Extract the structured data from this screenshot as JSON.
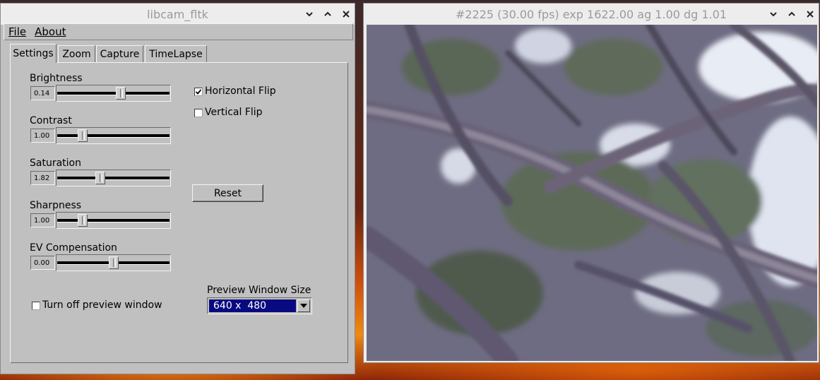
{
  "ctrl_window": {
    "title": "libcam_fltk",
    "menu": {
      "file": "File",
      "about": "About"
    },
    "tabs": [
      {
        "label": "Settings",
        "active": true
      },
      {
        "label": "Zoom",
        "active": false
      },
      {
        "label": "Capture",
        "active": false
      },
      {
        "label": "TimeLapse",
        "active": false
      }
    ],
    "sliders": [
      {
        "label": "Brightness",
        "value": "0.14",
        "min": -1.0,
        "max": 1.0,
        "position": 0.57
      },
      {
        "label": "Contrast",
        "value": "1.00",
        "min": 0.0,
        "max": 5.0,
        "position": 0.2
      },
      {
        "label": "Saturation",
        "value": "1.82",
        "min": 0.0,
        "max": 5.0,
        "position": 0.37
      },
      {
        "label": "Sharpness",
        "value": "1.00",
        "min": 0.0,
        "max": 5.0,
        "position": 0.2
      },
      {
        "label": "EV Compensation",
        "value": "0.00",
        "min": -10.0,
        "max": 10.0,
        "position": 0.5
      }
    ],
    "horizontal_flip": {
      "label": "Horizontal Flip",
      "checked": true
    },
    "vertical_flip": {
      "label": "Vertical Flip",
      "checked": false
    },
    "reset_label": "Reset",
    "turn_off_preview": {
      "label": "Turn off preview window",
      "checked": false
    },
    "preview_size": {
      "label": "Preview Window Size",
      "value": "640 x  480"
    }
  },
  "preview_window": {
    "title": "#2225 (30.00 fps) exp 1622.00 ag 1.00 dg 1.01"
  },
  "colors": {
    "panel_gray": "#c0c0c0",
    "select_highlight": "#0a0a80",
    "titlebar": "#ededed"
  }
}
